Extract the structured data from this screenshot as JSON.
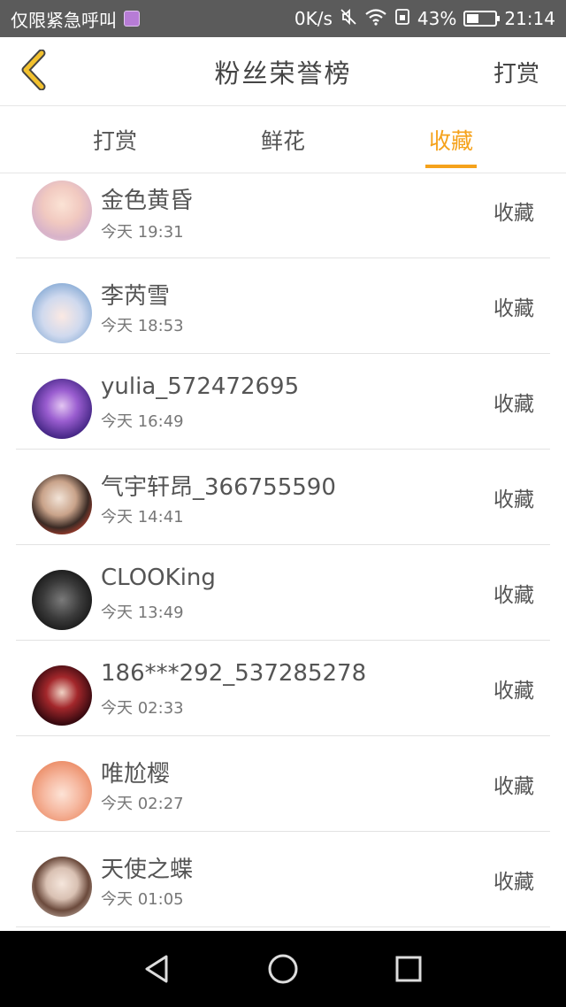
{
  "status_bar": {
    "carrier": "仅限紧急呼叫",
    "net_speed": "0K/s",
    "battery_percent": "43%",
    "battery_level": 0.43,
    "time": "21:14"
  },
  "header": {
    "title": "粉丝荣誉榜",
    "action_label": "打赏"
  },
  "tabs": [
    {
      "label": "打赏",
      "active": false
    },
    {
      "label": "鲜花",
      "active": false
    },
    {
      "label": "收藏",
      "active": true
    }
  ],
  "list": {
    "items": [
      {
        "name": "金色黄昏",
        "time": "今天 19:31",
        "action": "收藏"
      },
      {
        "name": "李芮雪",
        "time": "今天 18:53",
        "action": "收藏"
      },
      {
        "name": "yulia_572472695",
        "time": "今天 16:49",
        "action": "收藏"
      },
      {
        "name": "气宇轩昂_366755590",
        "time": "今天 14:41",
        "action": "收藏"
      },
      {
        "name": "CLOOKing",
        "time": "今天 13:49",
        "action": "收藏"
      },
      {
        "name": "186***292_537285278",
        "time": "今天 02:33",
        "action": "收藏"
      },
      {
        "name": "唯尬樱",
        "time": "今天 02:27",
        "action": "收藏"
      },
      {
        "name": "天使之蝶",
        "time": "今天 01:05",
        "action": "收藏"
      }
    ]
  },
  "colors": {
    "accent": "#f5a21b",
    "status_bar": "#5b5b5b",
    "nav_bar": "#000000"
  }
}
